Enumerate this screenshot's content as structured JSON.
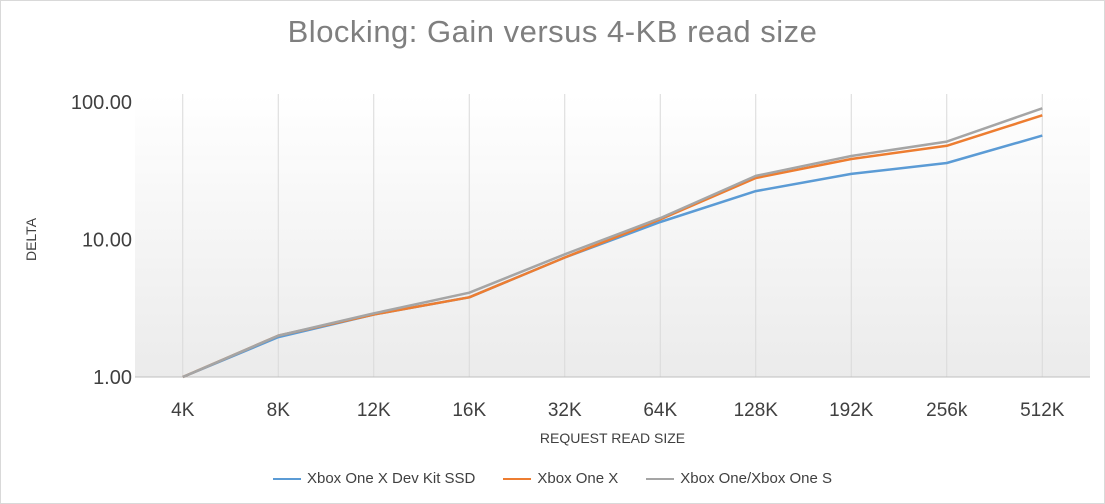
{
  "chart_data": {
    "type": "line",
    "title": "Blocking: Gain versus 4-KB read size",
    "xlabel": "REQUEST READ SIZE",
    "ylabel": "DELTA",
    "yscale": "log",
    "ylim": [
      1,
      100
    ],
    "yticks": [
      1,
      10,
      100
    ],
    "ytick_labels": [
      "1.00",
      "10.00",
      "100.00"
    ],
    "grid": "vertical",
    "legend_position": "bottom",
    "categories": [
      "4K",
      "8K",
      "12K",
      "16K",
      "32K",
      "64K",
      "128K",
      "192K",
      "256k",
      "512K"
    ],
    "series": [
      {
        "name": "Xbox One X Dev Kit SSD",
        "color": "#5b9bd5",
        "values": [
          1.0,
          1.95,
          2.85,
          3.8,
          7.4,
          13.4,
          22.5,
          30.0,
          36.0,
          57.0
        ]
      },
      {
        "name": "Xbox One X",
        "color": "#ed7d31",
        "values": [
          1.0,
          2.0,
          2.85,
          3.8,
          7.4,
          14.0,
          28.0,
          38.5,
          48.0,
          80.0
        ]
      },
      {
        "name": "Xbox One/Xbox One S",
        "color": "#a5a5a5",
        "values": [
          1.0,
          2.0,
          2.9,
          4.1,
          7.8,
          14.3,
          29.0,
          40.5,
          51.5,
          90.0
        ]
      }
    ]
  }
}
